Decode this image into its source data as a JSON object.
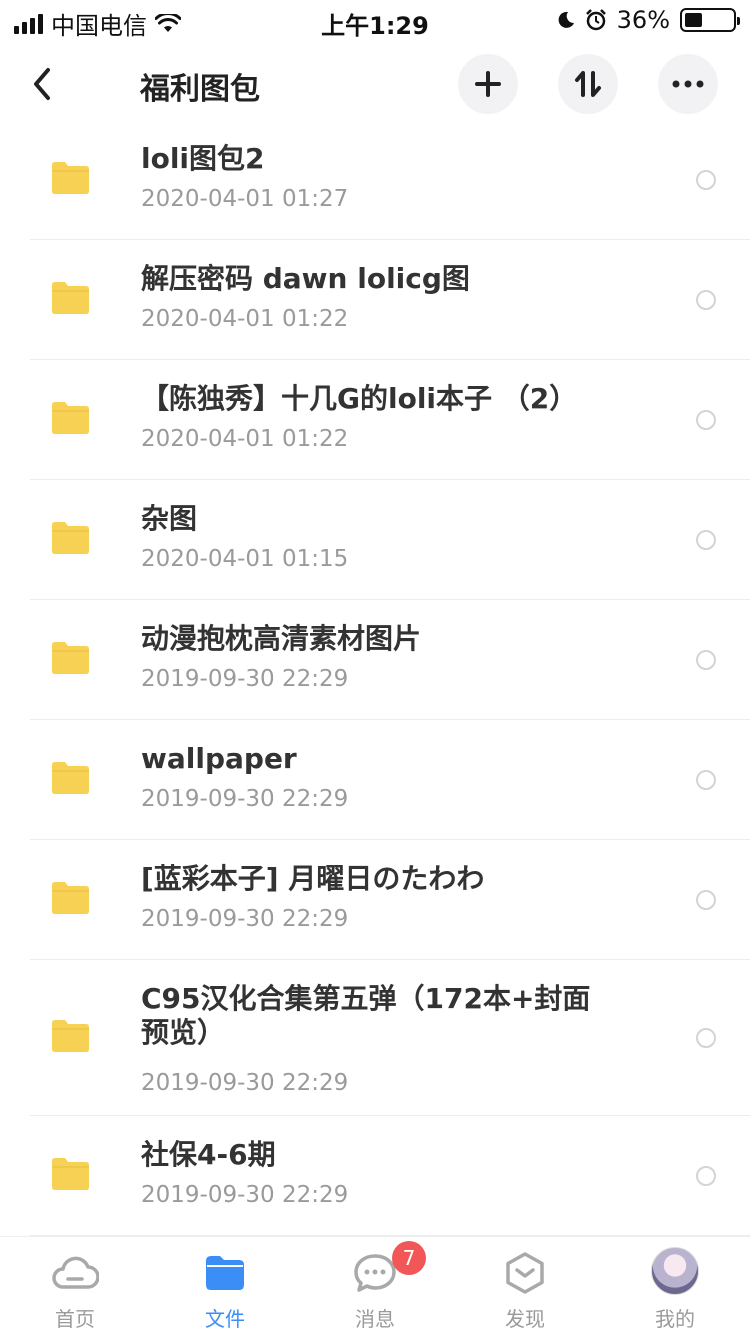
{
  "status_bar": {
    "carrier": "中国电信",
    "time": "上午1:29",
    "battery": "36%",
    "battery_level": 0.36
  },
  "header": {
    "title": "福利图包",
    "icons": [
      "back-icon",
      "plus-icon",
      "sort-icon",
      "more-icon"
    ]
  },
  "files": [
    {
      "name": "loli图包2",
      "date": "2020-04-01 01:27"
    },
    {
      "name": "解压密码 dawn   lolicg图",
      "date": "2020-04-01 01:22"
    },
    {
      "name": "【陈独秀】十几G的loli本子 （2）",
      "date": "2020-04-01 01:22"
    },
    {
      "name": "杂图",
      "date": "2020-04-01 01:15"
    },
    {
      "name": "动漫抱枕高清素材图片",
      "date": "2019-09-30 22:29"
    },
    {
      "name": "wallpaper",
      "date": "2019-09-30 22:29"
    },
    {
      "name": "[蓝彩本子] 月曜日のたわわ",
      "date": "2019-09-30 22:29"
    },
    {
      "name": "C95汉化合集第五弹（172本+封面预览）",
      "date": "2019-09-30 22:29"
    },
    {
      "name": "社保4-6期",
      "date": "2019-09-30 22:29"
    }
  ],
  "tabs": [
    {
      "label": "首页",
      "icon": "cloud-icon"
    },
    {
      "label": "文件",
      "icon": "folder-icon"
    },
    {
      "label": "消息",
      "icon": "chat-icon",
      "badge": "7"
    },
    {
      "label": "发现",
      "icon": "discover-icon"
    },
    {
      "label": "我的",
      "icon": "avatar"
    }
  ],
  "colors": {
    "accent": "#3a8ef6",
    "folder": "#f7d154",
    "badge": "#f25757"
  }
}
